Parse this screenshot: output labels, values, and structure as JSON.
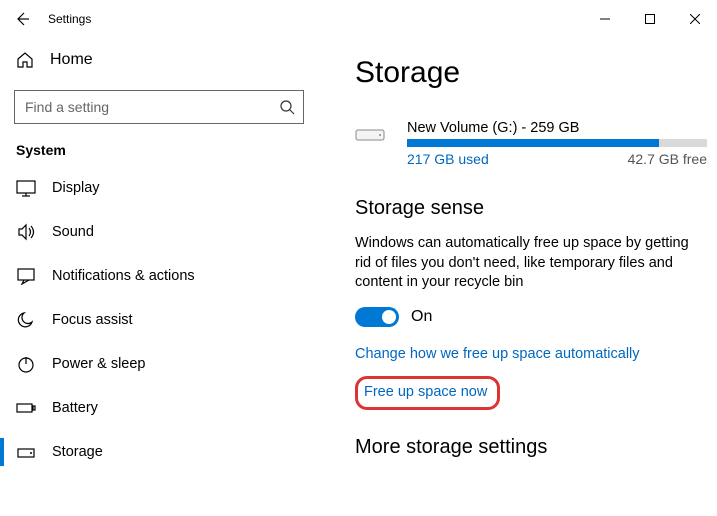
{
  "titlebar": {
    "title": "Settings"
  },
  "sidebar": {
    "home_label": "Home",
    "search_placeholder": "Find a setting",
    "group_label": "System",
    "items": [
      {
        "label": "Display"
      },
      {
        "label": "Sound"
      },
      {
        "label": "Notifications & actions"
      },
      {
        "label": "Focus assist"
      },
      {
        "label": "Power & sleep"
      },
      {
        "label": "Battery"
      },
      {
        "label": "Storage"
      }
    ]
  },
  "main": {
    "title": "Storage",
    "drive": {
      "name": "New Volume (G:) - 259 GB",
      "used_label": "217 GB used",
      "free_label": "42.7 GB free",
      "used_percent": 84
    },
    "sense": {
      "title": "Storage sense",
      "desc": "Windows can automatically free up space by getting rid of files you don't need, like temporary files and content in your recycle bin",
      "toggle_state": "On",
      "link1": "Change how we free up space automatically",
      "link2": "Free up space now"
    },
    "more_title": "More storage settings"
  }
}
